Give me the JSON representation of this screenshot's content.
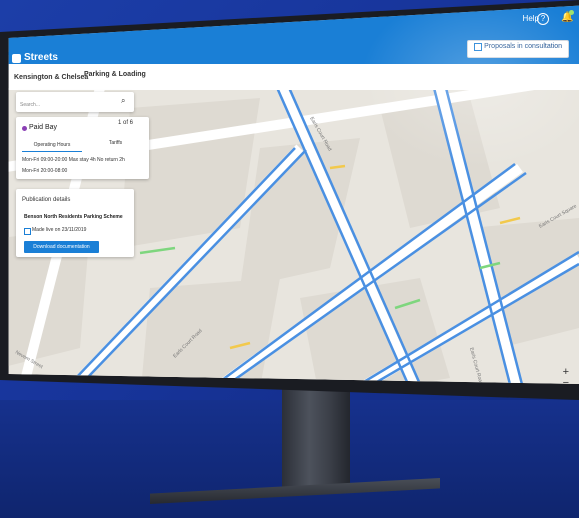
{
  "app": {
    "name": "Streets",
    "help_label": "Help",
    "help_icon": "?",
    "notification_icon": "bell-icon"
  },
  "toolbar": {
    "borough": "Kensington & Chelsea",
    "category": "Parking & Loading",
    "proposals_label": "Proposals in consultation"
  },
  "search": {
    "placeholder": "Search..."
  },
  "bay": {
    "type": "Paid Bay",
    "pager": "1 of 6",
    "tabs": [
      "Operating Hours",
      "Tariffs"
    ],
    "hours": [
      "Mon-Fri  09:00-20:00   Max stay 4h  No return 2h",
      "Mon-Fri  20:00-08:00"
    ]
  },
  "publication": {
    "title": "Publication details",
    "scheme": "Benson North Residents Parking Scheme",
    "made_live": "Made live on 23/11/2019",
    "download_label": "Download documentation"
  },
  "map": {
    "streets": [
      "Earls Court Road",
      "Earls Court Road",
      "Earls Court Square",
      "Earls Court Road",
      "Nevern Street"
    ],
    "zoom_in": "+",
    "zoom_out": "−"
  },
  "colors": {
    "brand": "#1a7fd6",
    "paid_bay": "#8b3fb5",
    "road_blue": "#4a90e2",
    "road_green": "#7ed67e",
    "road_yellow": "#f2c94c"
  }
}
